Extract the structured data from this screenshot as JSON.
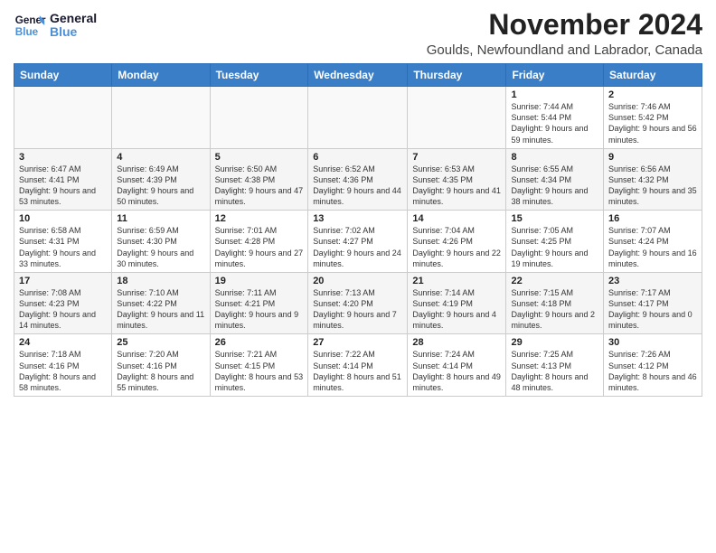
{
  "logo": {
    "text_general": "General",
    "text_blue": "Blue"
  },
  "title": "November 2024",
  "subtitle": "Goulds, Newfoundland and Labrador, Canada",
  "header": {
    "days": [
      "Sunday",
      "Monday",
      "Tuesday",
      "Wednesday",
      "Thursday",
      "Friday",
      "Saturday"
    ]
  },
  "weeks": [
    [
      {
        "day": "",
        "info": ""
      },
      {
        "day": "",
        "info": ""
      },
      {
        "day": "",
        "info": ""
      },
      {
        "day": "",
        "info": ""
      },
      {
        "day": "",
        "info": ""
      },
      {
        "day": "1",
        "info": "Sunrise: 7:44 AM\nSunset: 5:44 PM\nDaylight: 9 hours and 59 minutes."
      },
      {
        "day": "2",
        "info": "Sunrise: 7:46 AM\nSunset: 5:42 PM\nDaylight: 9 hours and 56 minutes."
      }
    ],
    [
      {
        "day": "3",
        "info": "Sunrise: 6:47 AM\nSunset: 4:41 PM\nDaylight: 9 hours and 53 minutes."
      },
      {
        "day": "4",
        "info": "Sunrise: 6:49 AM\nSunset: 4:39 PM\nDaylight: 9 hours and 50 minutes."
      },
      {
        "day": "5",
        "info": "Sunrise: 6:50 AM\nSunset: 4:38 PM\nDaylight: 9 hours and 47 minutes."
      },
      {
        "day": "6",
        "info": "Sunrise: 6:52 AM\nSunset: 4:36 PM\nDaylight: 9 hours and 44 minutes."
      },
      {
        "day": "7",
        "info": "Sunrise: 6:53 AM\nSunset: 4:35 PM\nDaylight: 9 hours and 41 minutes."
      },
      {
        "day": "8",
        "info": "Sunrise: 6:55 AM\nSunset: 4:34 PM\nDaylight: 9 hours and 38 minutes."
      },
      {
        "day": "9",
        "info": "Sunrise: 6:56 AM\nSunset: 4:32 PM\nDaylight: 9 hours and 35 minutes."
      }
    ],
    [
      {
        "day": "10",
        "info": "Sunrise: 6:58 AM\nSunset: 4:31 PM\nDaylight: 9 hours and 33 minutes."
      },
      {
        "day": "11",
        "info": "Sunrise: 6:59 AM\nSunset: 4:30 PM\nDaylight: 9 hours and 30 minutes."
      },
      {
        "day": "12",
        "info": "Sunrise: 7:01 AM\nSunset: 4:28 PM\nDaylight: 9 hours and 27 minutes."
      },
      {
        "day": "13",
        "info": "Sunrise: 7:02 AM\nSunset: 4:27 PM\nDaylight: 9 hours and 24 minutes."
      },
      {
        "day": "14",
        "info": "Sunrise: 7:04 AM\nSunset: 4:26 PM\nDaylight: 9 hours and 22 minutes."
      },
      {
        "day": "15",
        "info": "Sunrise: 7:05 AM\nSunset: 4:25 PM\nDaylight: 9 hours and 19 minutes."
      },
      {
        "day": "16",
        "info": "Sunrise: 7:07 AM\nSunset: 4:24 PM\nDaylight: 9 hours and 16 minutes."
      }
    ],
    [
      {
        "day": "17",
        "info": "Sunrise: 7:08 AM\nSunset: 4:23 PM\nDaylight: 9 hours and 14 minutes."
      },
      {
        "day": "18",
        "info": "Sunrise: 7:10 AM\nSunset: 4:22 PM\nDaylight: 9 hours and 11 minutes."
      },
      {
        "day": "19",
        "info": "Sunrise: 7:11 AM\nSunset: 4:21 PM\nDaylight: 9 hours and 9 minutes."
      },
      {
        "day": "20",
        "info": "Sunrise: 7:13 AM\nSunset: 4:20 PM\nDaylight: 9 hours and 7 minutes."
      },
      {
        "day": "21",
        "info": "Sunrise: 7:14 AM\nSunset: 4:19 PM\nDaylight: 9 hours and 4 minutes."
      },
      {
        "day": "22",
        "info": "Sunrise: 7:15 AM\nSunset: 4:18 PM\nDaylight: 9 hours and 2 minutes."
      },
      {
        "day": "23",
        "info": "Sunrise: 7:17 AM\nSunset: 4:17 PM\nDaylight: 9 hours and 0 minutes."
      }
    ],
    [
      {
        "day": "24",
        "info": "Sunrise: 7:18 AM\nSunset: 4:16 PM\nDaylight: 8 hours and 58 minutes."
      },
      {
        "day": "25",
        "info": "Sunrise: 7:20 AM\nSunset: 4:16 PM\nDaylight: 8 hours and 55 minutes."
      },
      {
        "day": "26",
        "info": "Sunrise: 7:21 AM\nSunset: 4:15 PM\nDaylight: 8 hours and 53 minutes."
      },
      {
        "day": "27",
        "info": "Sunrise: 7:22 AM\nSunset: 4:14 PM\nDaylight: 8 hours and 51 minutes."
      },
      {
        "day": "28",
        "info": "Sunrise: 7:24 AM\nSunset: 4:14 PM\nDaylight: 8 hours and 49 minutes."
      },
      {
        "day": "29",
        "info": "Sunrise: 7:25 AM\nSunset: 4:13 PM\nDaylight: 8 hours and 48 minutes."
      },
      {
        "day": "30",
        "info": "Sunrise: 7:26 AM\nSunset: 4:12 PM\nDaylight: 8 hours and 46 minutes."
      }
    ]
  ]
}
